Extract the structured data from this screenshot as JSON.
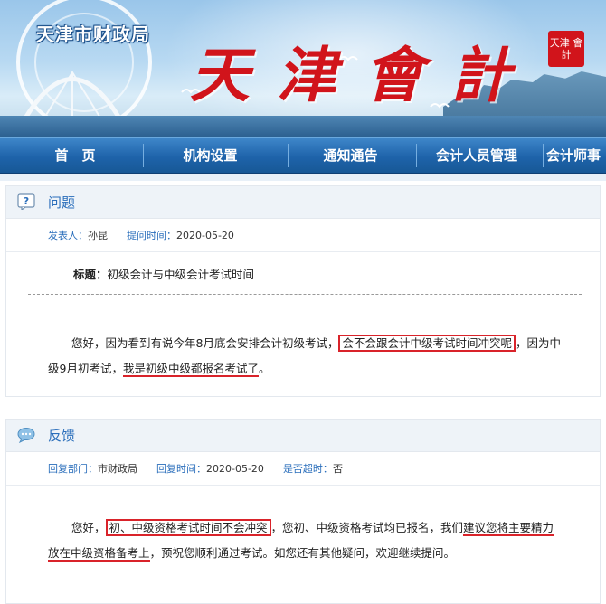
{
  "banner": {
    "agency": "天津市财政局",
    "title": "天津會計",
    "seal": "天津 會計"
  },
  "nav": {
    "items": [
      "首　页",
      "机构设置",
      "通知通告",
      "会计人员管理",
      "会计师事"
    ]
  },
  "question": {
    "heading": "问题",
    "poster_label": "发表人：",
    "poster": "孙昆",
    "time_label": "提问时间：",
    "time": "2020-05-20",
    "subject_label": "标题：",
    "subject": "初级会计与中级会计考试时间",
    "body_1": "您好，因为看到有说今年8月底会安排会计初级考试，",
    "body_2": "会不会跟会计中级考试时间冲突呢",
    "body_3": "，因为中",
    "body_4": "级9月初考试，",
    "body_5": "我是初级中级都报名考试了",
    "body_6": "。"
  },
  "feedback": {
    "heading": "反馈",
    "dept_label": "回复部门：",
    "dept": "市财政局",
    "time_label": "回复时间：",
    "time": "2020-05-20",
    "overdue_label": "是否超时：",
    "overdue": "否",
    "body_1": "您好，",
    "body_2": "初、中级资格考试时间不会冲突",
    "body_3": "，您初、中级资格考试均已报名，我们",
    "body_4": "建议您将主要精力",
    "body_5": "放在中级资格备考上",
    "body_6": "，预祝您顺利通过考试。如您还有其他疑问，欢迎继续提问。"
  }
}
